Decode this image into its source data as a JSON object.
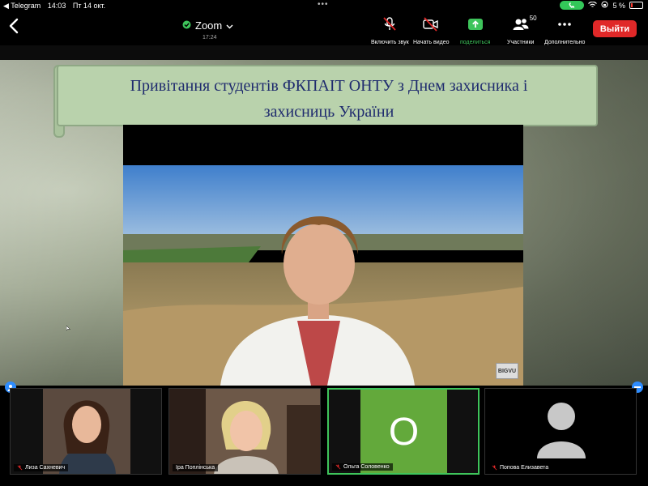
{
  "statusbar": {
    "back_app": "◀ Telegram",
    "time": "14:03",
    "date": "Пт 14 окт.",
    "battery": "5 %"
  },
  "toolbar": {
    "meeting_name": "Zoom",
    "meeting_time": "17:24",
    "buttons": {
      "unmute": "Включить звук",
      "start_video": "Начать видео",
      "share": "поделиться",
      "participants": "Участники",
      "participants_count": "50",
      "more": "Дополнительно"
    },
    "leave": "Выйти",
    "colors": {
      "share_green": "#3ec45b",
      "leave_red": "#e02828"
    }
  },
  "slide": {
    "title_line1": "Привітання студентів ФКПАІТ ОНТУ  з Днем захисника і",
    "title_line2": "захисниць України"
  },
  "video": {
    "watermark": "BIGVU"
  },
  "participants": [
    {
      "name": "Лиза Сахневич",
      "muted": true
    },
    {
      "name": "Іра Поплінська",
      "muted": false
    },
    {
      "name": "Ольга Соловенко",
      "muted": true,
      "initial": "O",
      "tile_color": "#63a93b"
    },
    {
      "name": "Попова Елизавета",
      "muted": true
    }
  ]
}
